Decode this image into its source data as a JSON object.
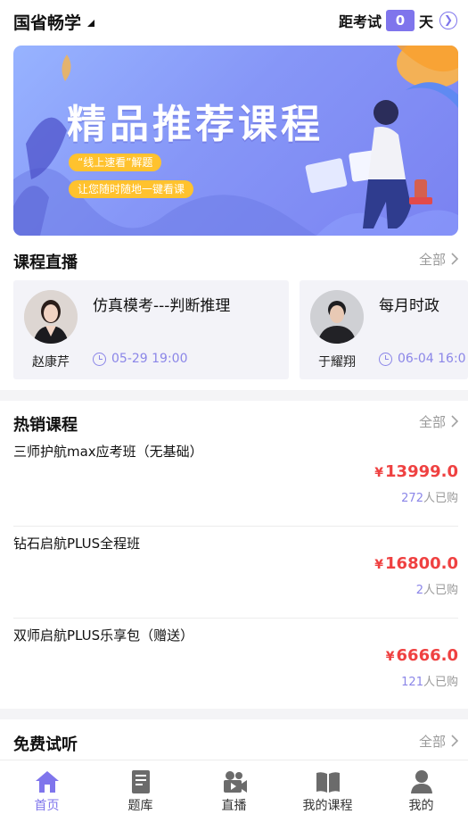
{
  "header": {
    "exam_name": "国省畅学",
    "countdown_label": "距考试",
    "countdown_days": "0",
    "countdown_unit": "天"
  },
  "banner": {
    "title": "精品推荐课程",
    "pill1": "“线上速看”解题",
    "pill2": "让您随时随地一键看课"
  },
  "live": {
    "title": "课程直播",
    "all_label": "全部",
    "items": [
      {
        "teacher": "赵康芹",
        "title": "仿真模考---判断推理",
        "time": "05-29 19:00"
      },
      {
        "teacher": "于耀翔",
        "title": "每月时政",
        "time": "06-04 16:0"
      }
    ]
  },
  "hot": {
    "title": "热销课程",
    "all_label": "全部",
    "items": [
      {
        "name": "三师护航max应考班（无基础）",
        "yen": "¥",
        "price": "13999.0",
        "count": "272",
        "suffix": "人已购"
      },
      {
        "name": "钻石启航PLUS全程班",
        "yen": "¥",
        "price": "16800.0",
        "count": "2",
        "suffix": "人已购"
      },
      {
        "name": "双师启航PLUS乐享包（赠送）",
        "yen": "¥",
        "price": "6666.0",
        "count": "121",
        "suffix": "人已购"
      }
    ]
  },
  "free": {
    "title": "免费试听",
    "all_label": "全部"
  },
  "tabbar": {
    "items": [
      {
        "label": "首页",
        "icon": "home-icon",
        "active": true
      },
      {
        "label": "题库",
        "icon": "question-bank-icon",
        "active": false
      },
      {
        "label": "直播",
        "icon": "live-camera-icon",
        "active": false
      },
      {
        "label": "我的课程",
        "icon": "book-icon",
        "active": false
      },
      {
        "label": "我的",
        "icon": "user-icon",
        "active": false
      }
    ]
  },
  "colors": {
    "accent": "#7f75ec",
    "price": "#ef4141",
    "pill": "#ffc22e"
  }
}
